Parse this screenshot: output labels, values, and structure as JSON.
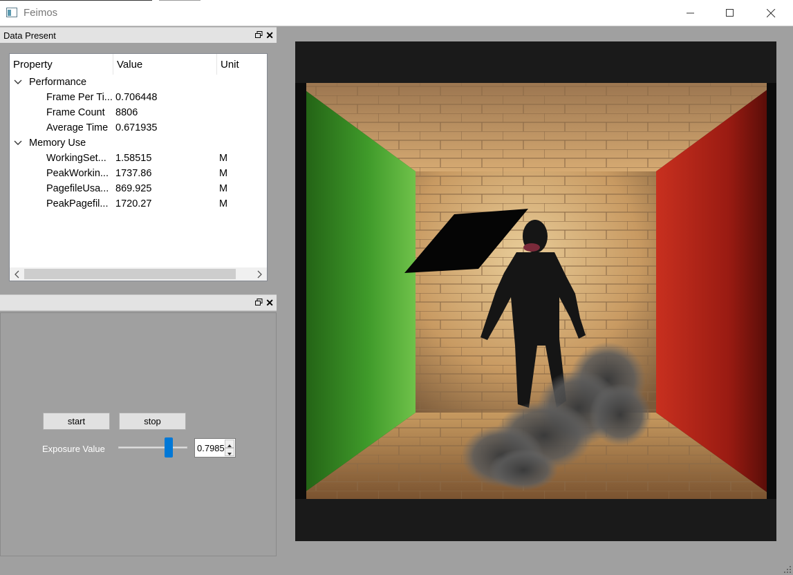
{
  "window": {
    "title": "Feimos",
    "app_icon": "window-app-icon",
    "controls": [
      "minimize-icon",
      "maximize-icon",
      "close-icon"
    ]
  },
  "data_panel": {
    "title": "Data Present",
    "float_icon": "float-icon",
    "close_icon": "close-icon",
    "columns": [
      "Property",
      "Value",
      "Unit"
    ],
    "groups": [
      {
        "label": "Performance",
        "expanded": true,
        "rows": [
          {
            "property": "Frame Per Ti...",
            "value": "0.706448",
            "unit": ""
          },
          {
            "property": "Frame Count",
            "value": "8806",
            "unit": ""
          },
          {
            "property": "Average Time",
            "value": "0.671935",
            "unit": ""
          }
        ]
      },
      {
        "label": "Memory Use",
        "expanded": true,
        "rows": [
          {
            "property": "WorkingSet...",
            "value": "1.58515",
            "unit": "M"
          },
          {
            "property": "PeakWorkin...",
            "value": "1737.86",
            "unit": "M"
          },
          {
            "property": "PagefileUsa...",
            "value": "869.925",
            "unit": "M"
          },
          {
            "property": "PeakPagefil...",
            "value": "1720.27",
            "unit": "M"
          }
        ]
      }
    ]
  },
  "control_panel": {
    "title": "",
    "start_label": "start",
    "stop_label": "stop",
    "exposure_label": "Exposure Value",
    "exposure_value": "0.7985",
    "exposure_slider_fraction": 0.76
  },
  "render_view": {
    "scene": "Cornell box with brick walls, figure and smoke",
    "left_wall_color": "#3a9a2a",
    "right_wall_color": "#b8221a",
    "background_color": "#1a1a1a"
  },
  "colors": {
    "accent": "#0078d7",
    "panel_bg": "#a0a0a0"
  }
}
